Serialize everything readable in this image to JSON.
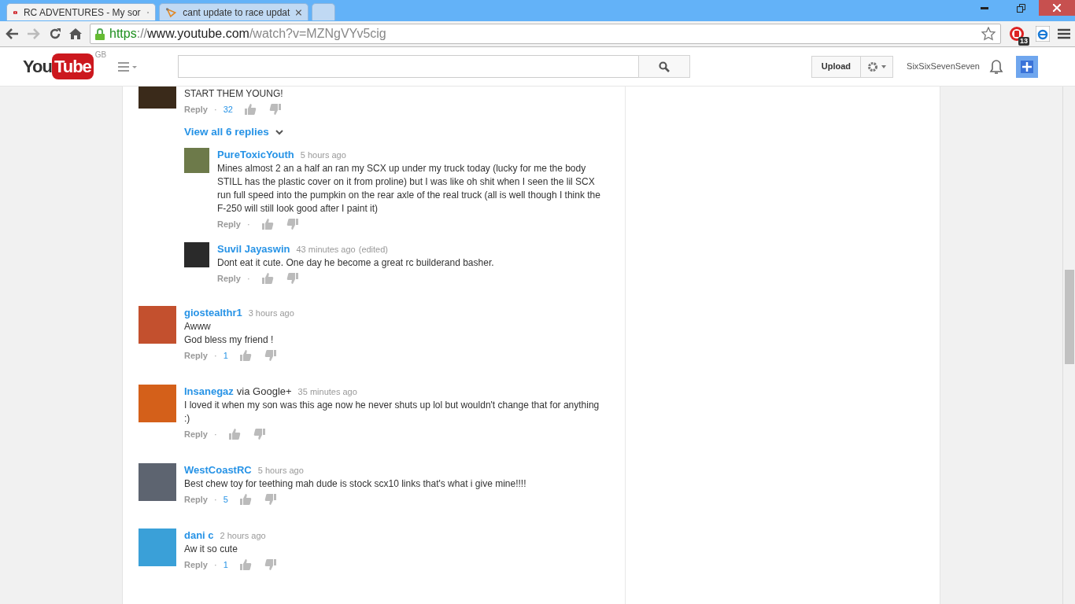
{
  "browser": {
    "tabs": [
      {
        "title": "RC ADVENTURES - My sor",
        "selected": true
      },
      {
        "title": "cant update to race updat",
        "selected": false
      }
    ],
    "address": {
      "scheme": "https",
      "separator": "://",
      "host": "www.youtube.com",
      "path": "/watch?v=MZNgVYv5cig"
    },
    "extension_badge": "13"
  },
  "header": {
    "logo_you": "You",
    "logo_tube": "Tube",
    "region": "GB",
    "upload": "Upload",
    "username": "SixSixSevenSeven"
  },
  "thread": {
    "text": "START THEM YOUNG!",
    "reply": "Reply",
    "separator": "·",
    "likes": "32",
    "view_replies": "View all 6 replies",
    "replies": [
      {
        "author": "PureToxicYouth",
        "time": "5 hours ago",
        "text": "Mines almost 2 an a half an ran my SCX up under my truck today (lucky for me the body STILL has the plastic cover on it from proline) but I was like oh shit when I seen the lil SCX run full speed into the pumpkin on the rear axle of the real truck (all is well though I think the F-250 will still look good after I paint it)",
        "reply": "Reply",
        "separator": "·"
      },
      {
        "author": "Suvil Jayaswin",
        "time": "43 minutes ago",
        "edited": "(edited)",
        "text": "Dont eat it cute. One day he become a great rc builderand basher.",
        "reply": "Reply",
        "separator": "·"
      }
    ]
  },
  "comments": [
    {
      "author": "giostealthr1",
      "time": "3 hours ago",
      "text": "Awww\nGod bless my friend !",
      "reply": "Reply",
      "separator": "·",
      "likes": "1"
    },
    {
      "author": "Insanegaz",
      "via": "via Google+",
      "time": "35 minutes ago",
      "text": "I loved it when my son was this age now he never shuts up lol but wouldn't change that for anything :)",
      "reply": "Reply",
      "separator": "·"
    },
    {
      "author": "WestCoastRC",
      "time": "5 hours ago",
      "text": "Best chew toy for teething mah dude is stock scx10 links that's what i give mine!!!!",
      "reply": "Reply",
      "separator": "·",
      "likes": "5"
    },
    {
      "author": "dani c",
      "time": "2 hours ago",
      "text": "Aw it so cute",
      "reply": "Reply",
      "separator": "·",
      "likes": "1"
    }
  ]
}
